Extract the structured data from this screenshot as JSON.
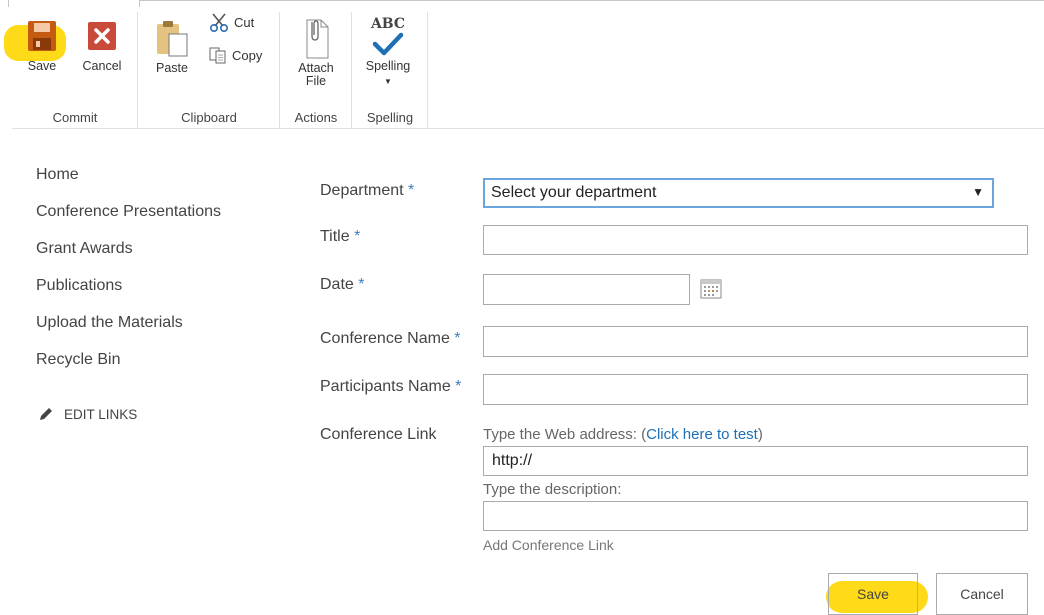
{
  "ribbon": {
    "commit": {
      "label": "Commit",
      "save": "Save",
      "cancel": "Cancel"
    },
    "clipboard": {
      "label": "Clipboard",
      "paste": "Paste",
      "cut": "Cut",
      "copy": "Copy"
    },
    "actions": {
      "label": "Actions",
      "attach_line1": "Attach",
      "attach_line2": "File"
    },
    "spelling": {
      "label": "Spelling",
      "spelling": "Spelling",
      "abc": "ABC"
    }
  },
  "nav": {
    "items": [
      "Home",
      "Conference Presentations",
      "Grant Awards",
      "Publications",
      "Upload the Materials",
      "Recycle Bin"
    ],
    "edit_links": "EDIT LINKS"
  },
  "form": {
    "required_mark": "*",
    "department": {
      "label": "Department",
      "value": "Select your department"
    },
    "title": {
      "label": "Title",
      "value": ""
    },
    "date": {
      "label": "Date",
      "value": ""
    },
    "conference_name": {
      "label": "Conference Name",
      "value": ""
    },
    "participants_name": {
      "label": "Participants Name",
      "value": ""
    },
    "conference_link": {
      "label": "Conference Link",
      "web_hint": "Type the Web address: (",
      "test_link": "Click here to test",
      "web_hint_close": ")",
      "url_value": "http://",
      "desc_hint": "Type the description:",
      "desc_value": "",
      "add_link": "Add Conference Link"
    },
    "save": "Save",
    "cancel": "Cancel"
  },
  "colors": {
    "highlight": "#ffd600",
    "accent": "#3e7fc1",
    "save_icon": "#c55a11",
    "cancel_icon": "#c94a3b",
    "check": "#1f6fb5"
  }
}
